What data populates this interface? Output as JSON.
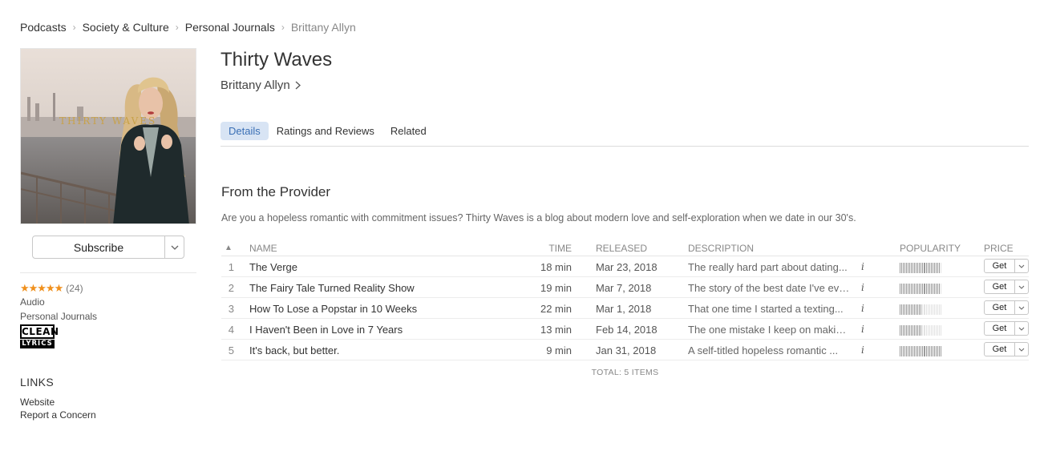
{
  "breadcrumb": {
    "items": [
      "Podcasts",
      "Society & Culture",
      "Personal Journals",
      "Brittany Allyn"
    ]
  },
  "podcast": {
    "title": "Thirty Waves",
    "artist": "Brittany Allyn",
    "artwork_text": "THIRTY WAVES"
  },
  "subscribe": {
    "label": "Subscribe"
  },
  "rating": {
    "stars": "★★★★★",
    "count": "(24)",
    "value": 5
  },
  "meta": {
    "kind": "Audio",
    "genre": "Personal Journals"
  },
  "badge": {
    "line1": "CLEAN",
    "line2": "LYRICS"
  },
  "links": {
    "title": "LINKS",
    "items": [
      "Website",
      "Report a Concern"
    ]
  },
  "tabs": {
    "items": [
      "Details",
      "Ratings and Reviews",
      "Related"
    ],
    "active": "Details"
  },
  "provider": {
    "title": "From the Provider",
    "description": "Are you a hopeless romantic with commitment issues? Thirty Waves is a blog about modern love and self-exploration when we date in our 30's."
  },
  "table": {
    "sort_arrow": "▲",
    "headers": {
      "name": "NAME",
      "time": "TIME",
      "released": "RELEASED",
      "description": "DESCRIPTION",
      "popularity": "POPULARITY",
      "price": "PRICE"
    },
    "info_glyph": "i",
    "get_label": "Get",
    "rows": [
      {
        "num": "1",
        "name": "The Verge",
        "time": "18 min",
        "released": "Mar 23, 2018",
        "description": "The really hard part about dating...",
        "popularity": 0.95
      },
      {
        "num": "2",
        "name": "The Fairy Tale Turned Reality Show",
        "time": "19 min",
        "released": "Mar 7, 2018",
        "description": "The story of the best date I've ever...",
        "popularity": 0.95
      },
      {
        "num": "3",
        "name": "How To Lose a Popstar in 10 Weeks",
        "time": "22 min",
        "released": "Mar 1, 2018",
        "description": "That one time I started a texting...",
        "popularity": 0.55
      },
      {
        "num": "4",
        "name": "I Haven't Been in Love in 7 Years",
        "time": "13 min",
        "released": "Feb 14, 2018",
        "description": "The one mistake I keep on making...",
        "popularity": 0.55
      },
      {
        "num": "5",
        "name": "It's back, but better.",
        "time": "9 min",
        "released": "Jan 31, 2018",
        "description": "A self-titled hopeless romantic ...",
        "popularity": 1.0
      }
    ],
    "total": "TOTAL: 5 ITEMS"
  },
  "colors": {
    "accent": "#3a6fb5",
    "tab_active_bg": "#d8e4f4",
    "star": "#f0901c",
    "pop_filled": "#9a9a9a",
    "pop_empty": "#e2e2e2"
  }
}
